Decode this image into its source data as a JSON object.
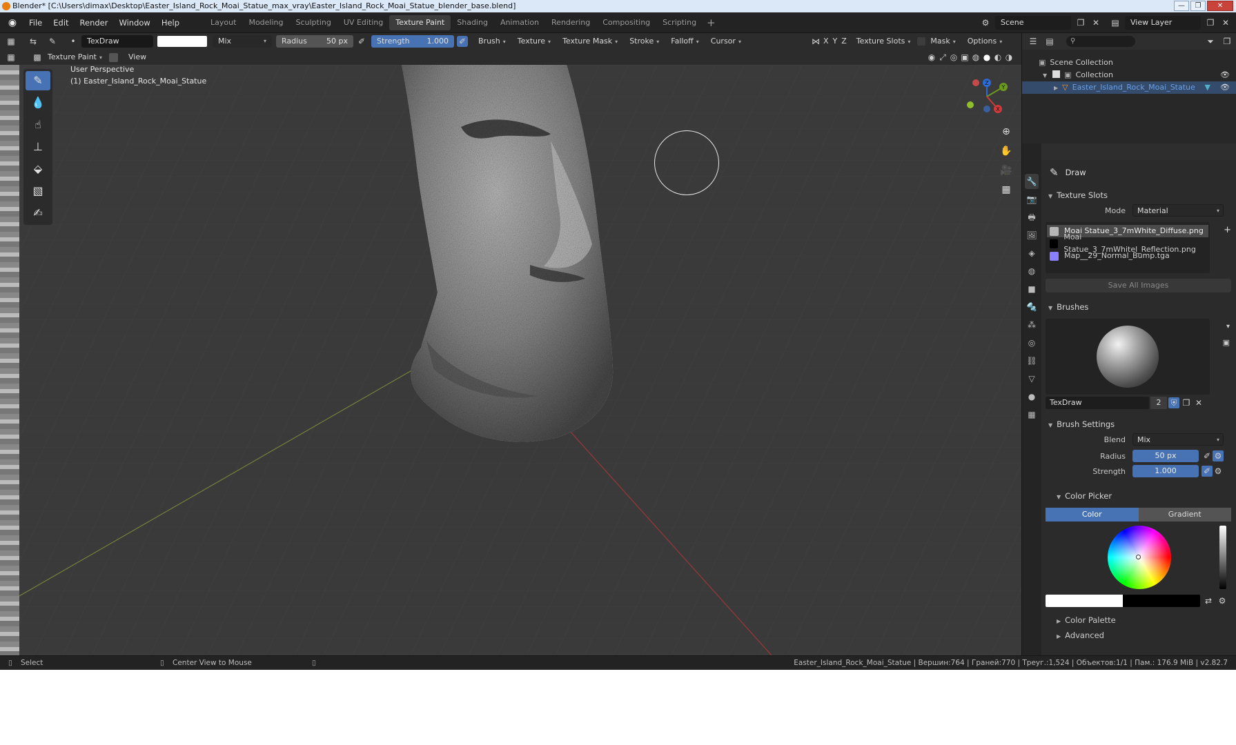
{
  "window": {
    "title": "Blender* [C:\\Users\\dimax\\Desktop\\Easter_Island_Rock_Moai_Statue_max_vray\\Easter_Island_Rock_Moai_Statue_blender_base.blend]"
  },
  "menu": [
    "File",
    "Edit",
    "Render",
    "Window",
    "Help"
  ],
  "workspaces": [
    "Layout",
    "Modeling",
    "Sculpting",
    "UV Editing",
    "Texture Paint",
    "Shading",
    "Animation",
    "Rendering",
    "Compositing",
    "Scripting"
  ],
  "active_workspace": "Texture Paint",
  "scene": {
    "label": "Scene",
    "view_layer": "View Layer"
  },
  "tool_header": {
    "brush_name": "TexDraw",
    "blend": "Mix",
    "radius_label": "Radius",
    "radius_value": "50 px",
    "strength_label": "Strength",
    "strength_value": "1.000",
    "menus": [
      "Brush",
      "Texture",
      "Texture Mask",
      "Stroke",
      "Falloff",
      "Cursor"
    ],
    "right": {
      "axes": [
        "X",
        "Y",
        "Z"
      ],
      "texture_slots": "Texture Slots",
      "mask": "Mask",
      "options": "Options"
    }
  },
  "mode_header": {
    "mode": "Texture Paint",
    "view": "View"
  },
  "viewport": {
    "perspective": "User Perspective",
    "object": "(1) Easter_Island_Rock_Moai_Statue"
  },
  "tools": [
    "draw-tool",
    "soften-tool",
    "smear-tool",
    "clone-tool",
    "fill-tool",
    "mask-tool",
    "annotate-tool"
  ],
  "outliner": {
    "root": "Scene Collection",
    "collection": "Collection",
    "object": "Easter_Island_Rock_Moai_Statue"
  },
  "properties": {
    "brush_tool": "Draw",
    "texture_slots": {
      "title": "Texture Slots",
      "mode_label": "Mode",
      "mode_value": "Material",
      "slots": [
        {
          "name": "Moai Statue_3_7mWhite_Diffuse.png",
          "color": "#b5b5b5"
        },
        {
          "name": "Moai Statue_3_7mWhitel_Reflection.png",
          "color": "#000000"
        },
        {
          "name": "Map__29_Normal_Bump.tga",
          "color": "#8a80ff"
        }
      ],
      "save_all": "Save All Images"
    },
    "brushes": {
      "title": "Brushes",
      "name": "TexDraw",
      "users": "2"
    },
    "brush_settings": {
      "title": "Brush Settings",
      "blend_label": "Blend",
      "blend_value": "Mix",
      "radius_label": "Radius",
      "radius_value": "50 px",
      "strength_label": "Strength",
      "strength_value": "1.000"
    },
    "color_picker": {
      "title": "Color Picker",
      "tab_color": "Color",
      "tab_gradient": "Gradient"
    },
    "color_palette": "Color Palette",
    "advanced": "Advanced"
  },
  "statusbar": {
    "select": "Select",
    "center": "Center View to Mouse",
    "info": "Easter_Island_Rock_Moai_Statue | Вершин:764 | Граней:770 | Треуг.:1,524 | Объектов:1/1 | Пам.: 176.9 MiB | v2.82.7"
  }
}
